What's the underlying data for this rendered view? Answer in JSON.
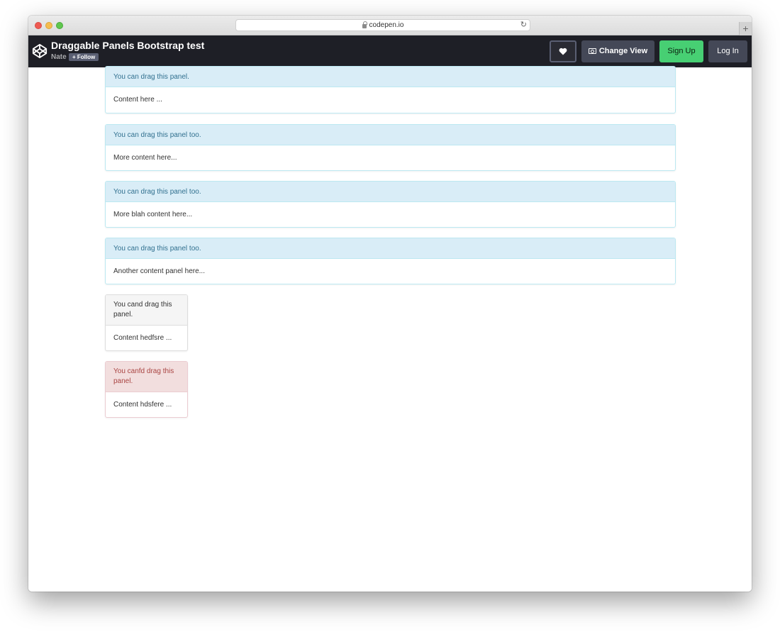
{
  "browser": {
    "url": "codepen.io",
    "new_tab_symbol": "+"
  },
  "header": {
    "pen_title": "Draggable Panels Bootstrap test",
    "author": "Nate",
    "follow_label": "+ Follow",
    "change_view_label": "Change View",
    "sign_up_label": "Sign Up",
    "log_in_label": "Log In"
  },
  "panels": [
    {
      "heading": "You can drag this panel.",
      "body": "Content here ...",
      "style": "info"
    },
    {
      "heading": "You can drag this panel too.",
      "body": "More content here...",
      "style": "info"
    },
    {
      "heading": "You can drag this panel too.",
      "body": "More blah content here...",
      "style": "info"
    },
    {
      "heading": "You can drag this panel too.",
      "body": "Another content panel here...",
      "style": "info"
    },
    {
      "heading": "You cand drag this panel.",
      "body": "Content hedfsre ...",
      "style": "default"
    },
    {
      "heading": "You canfd drag this panel.",
      "body": "Content hdsfere ...",
      "style": "danger"
    }
  ],
  "colors": {
    "header_bg": "#1e1f26",
    "sign_up_green": "#47cf73",
    "info_heading_bg": "#d9edf7",
    "info_heading_text": "#31708f",
    "danger_heading_bg": "#f2dede",
    "danger_heading_text": "#a94442"
  },
  "icons": [
    "codepen-logo-icon",
    "lock-icon",
    "reload-icon",
    "heart-icon",
    "change-view-icon"
  ]
}
